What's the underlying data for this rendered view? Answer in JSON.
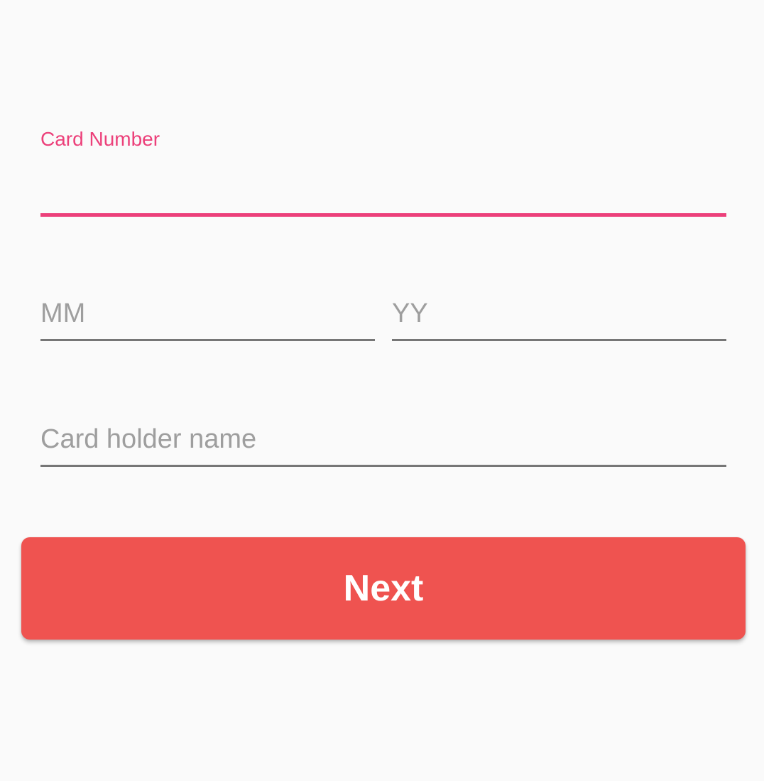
{
  "form": {
    "card_number": {
      "label": "Card Number",
      "value": ""
    },
    "expiry_month": {
      "placeholder": "MM",
      "value": ""
    },
    "expiry_year": {
      "placeholder": "YY",
      "value": ""
    },
    "card_holder": {
      "placeholder": "Card holder name",
      "value": ""
    },
    "next_label": "Next"
  },
  "colors": {
    "background": "#fafafa",
    "accent": "#ec407a",
    "button": "#ef5350",
    "hint_text": "#9e9e9e",
    "underline": "#767676"
  }
}
